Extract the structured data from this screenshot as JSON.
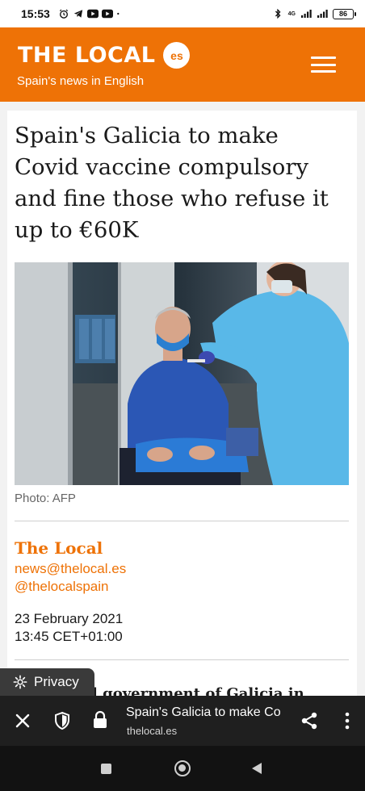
{
  "status_bar": {
    "time": "15:53",
    "icons": [
      "alarm-icon",
      "telegram-icon",
      "youtube-icon",
      "youtube-icon",
      "dot-icon"
    ],
    "network": "4G",
    "battery": "86"
  },
  "header": {
    "logo": "THE LOCAL",
    "badge": "es",
    "tagline": "Spain's news in English",
    "brand_color": "#ee7206"
  },
  "article": {
    "headline": "Spain's Galicia to make Covid vaccine compulsory and fine those who refuse it up to €60K",
    "photo_credit": "Photo: AFP",
    "author": {
      "name": "The Local",
      "email": "news@thelocal.es",
      "handle": "@thelocalspain"
    },
    "date": "23 February 2021",
    "time": "13:45 CET+01:00",
    "body_partial": "l government of Galicia in"
  },
  "privacy_button": {
    "label": "Privacy"
  },
  "browser_bar": {
    "page_title": "Spain's Galicia to make Co",
    "domain": "thelocal.es"
  }
}
